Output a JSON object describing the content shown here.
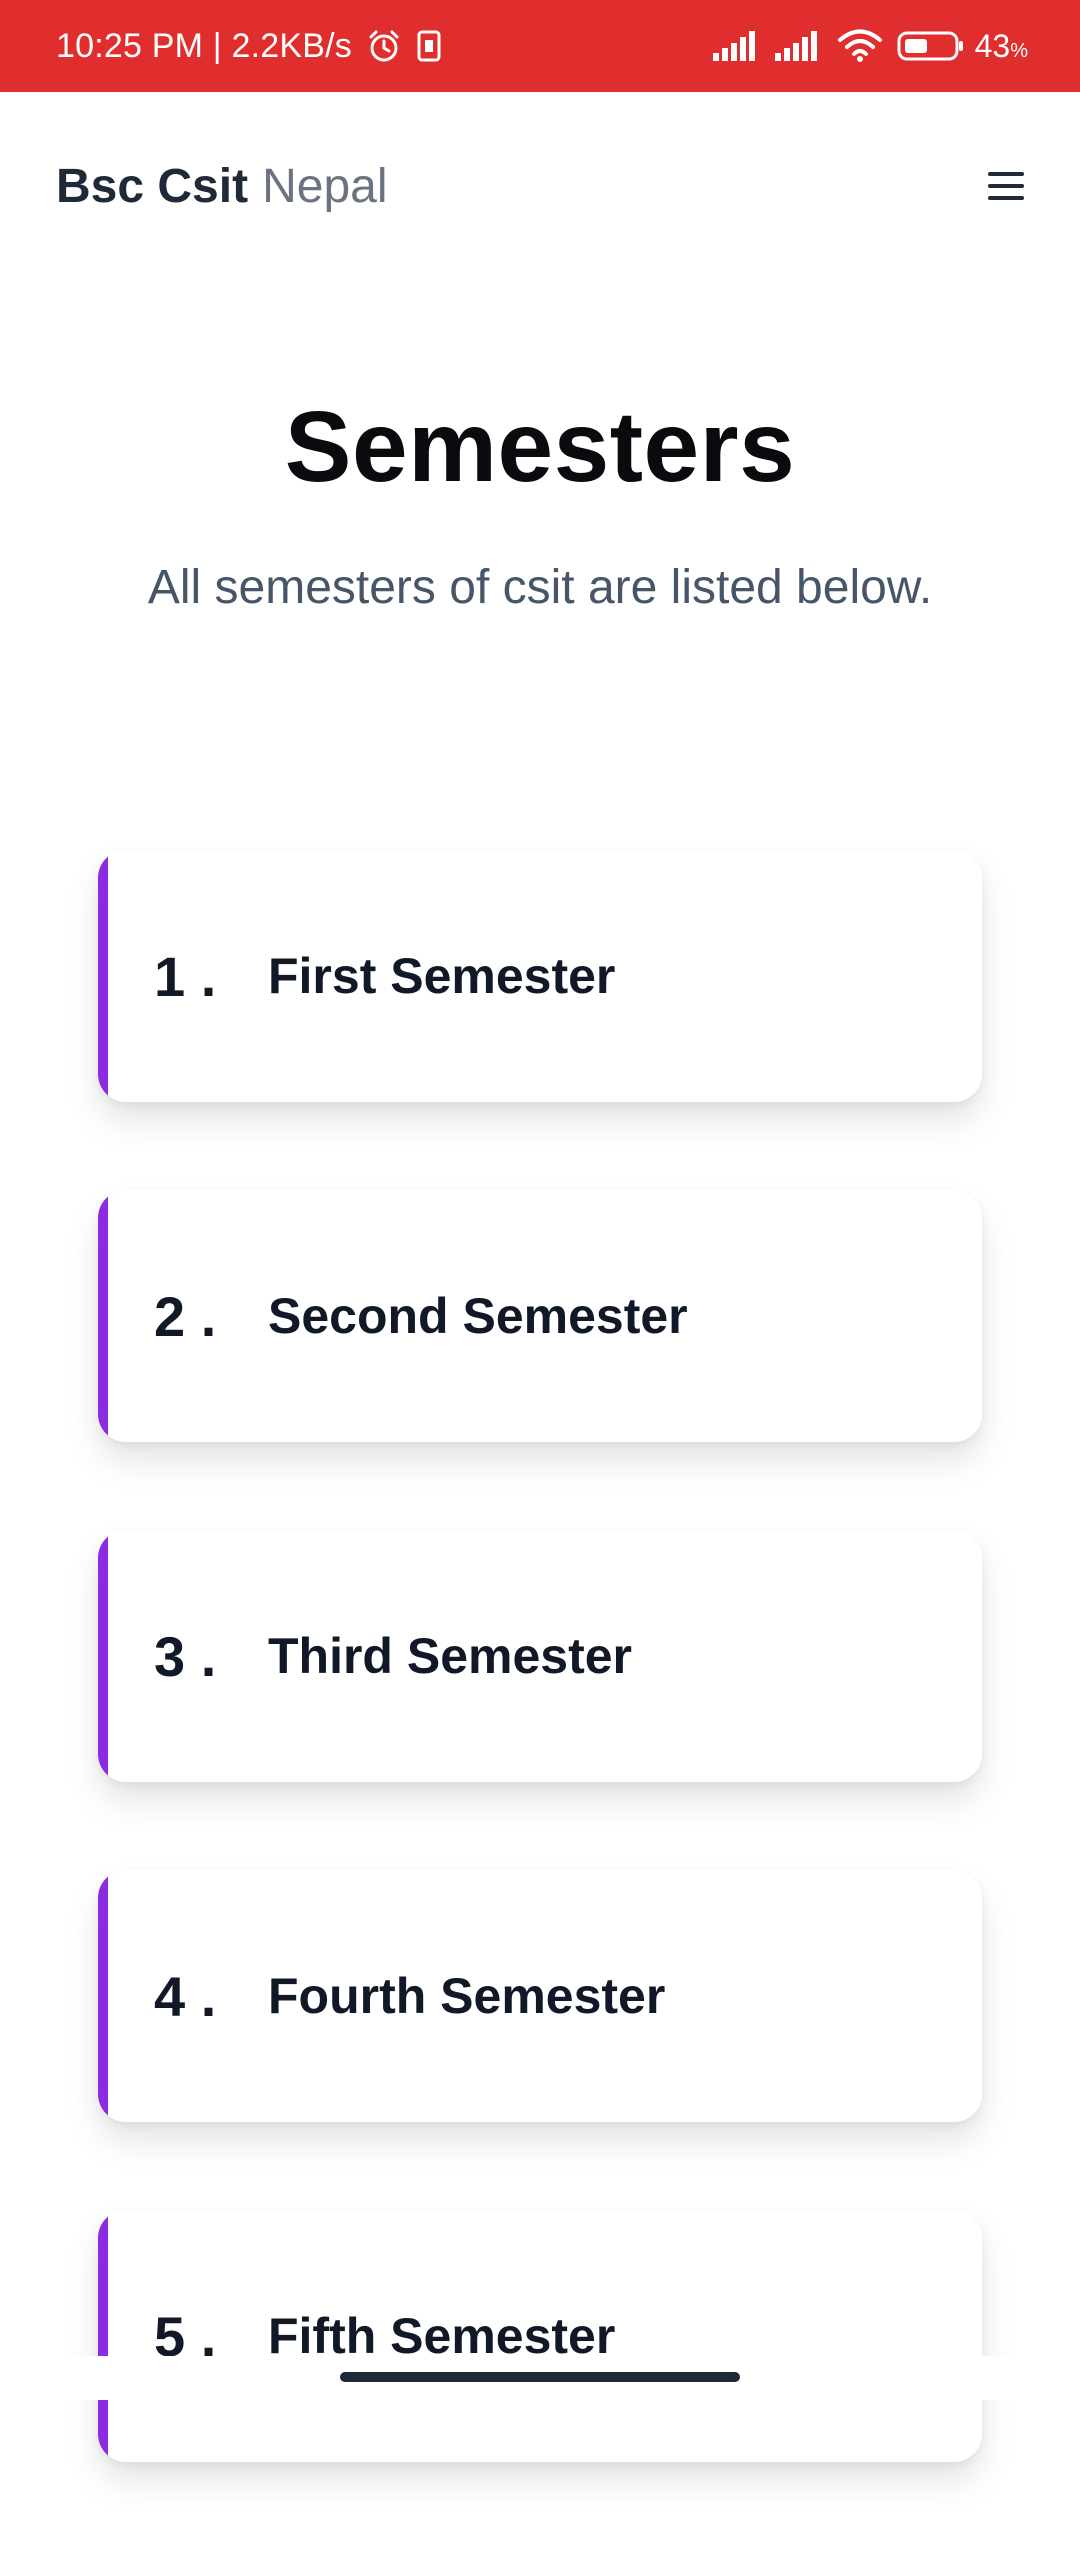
{
  "status_bar": {
    "time_and_speed": "10:25 PM | 2.2KB/s",
    "battery_percent": "43",
    "battery_suffix": "%"
  },
  "navbar": {
    "brand_strong": "Bsc Csit",
    "brand_light": "Nepal"
  },
  "header": {
    "title": "Semesters",
    "subtitle": "All semesters of csit are listed below."
  },
  "semesters": [
    {
      "number": "1 .",
      "name": "First Semester"
    },
    {
      "number": "2 .",
      "name": "Second Semester"
    },
    {
      "number": "3 .",
      "name": "Third Semester"
    },
    {
      "number": "4 .",
      "name": "Fourth Semester"
    },
    {
      "number": "5 .",
      "name": "Fifth Semester"
    }
  ],
  "colors": {
    "status_bar": "#e02d2d",
    "accent": "#8b2be2"
  }
}
